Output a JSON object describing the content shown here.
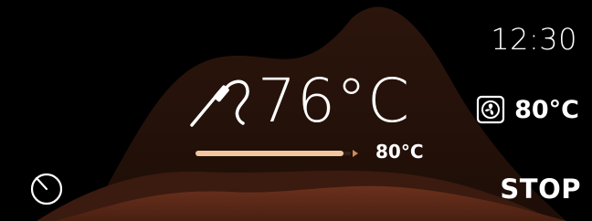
{
  "header": {
    "clock": "12:30"
  },
  "probe": {
    "current_temp": "76°C",
    "target_temp": "80°C",
    "progress_fraction": 0.95
  },
  "oven": {
    "mode_icon": "fan-icon",
    "set_temp": "80°C"
  },
  "controls": {
    "timer_icon": "timer-icon",
    "stop_label": "STOP"
  },
  "colors": {
    "background": "#000000",
    "text": "#ffffff",
    "progress_fill": "#f3c6a0",
    "progress_end": "#cf8a55",
    "glow_dark": "#2a130b",
    "glow_warm": "#6a2f1c"
  }
}
